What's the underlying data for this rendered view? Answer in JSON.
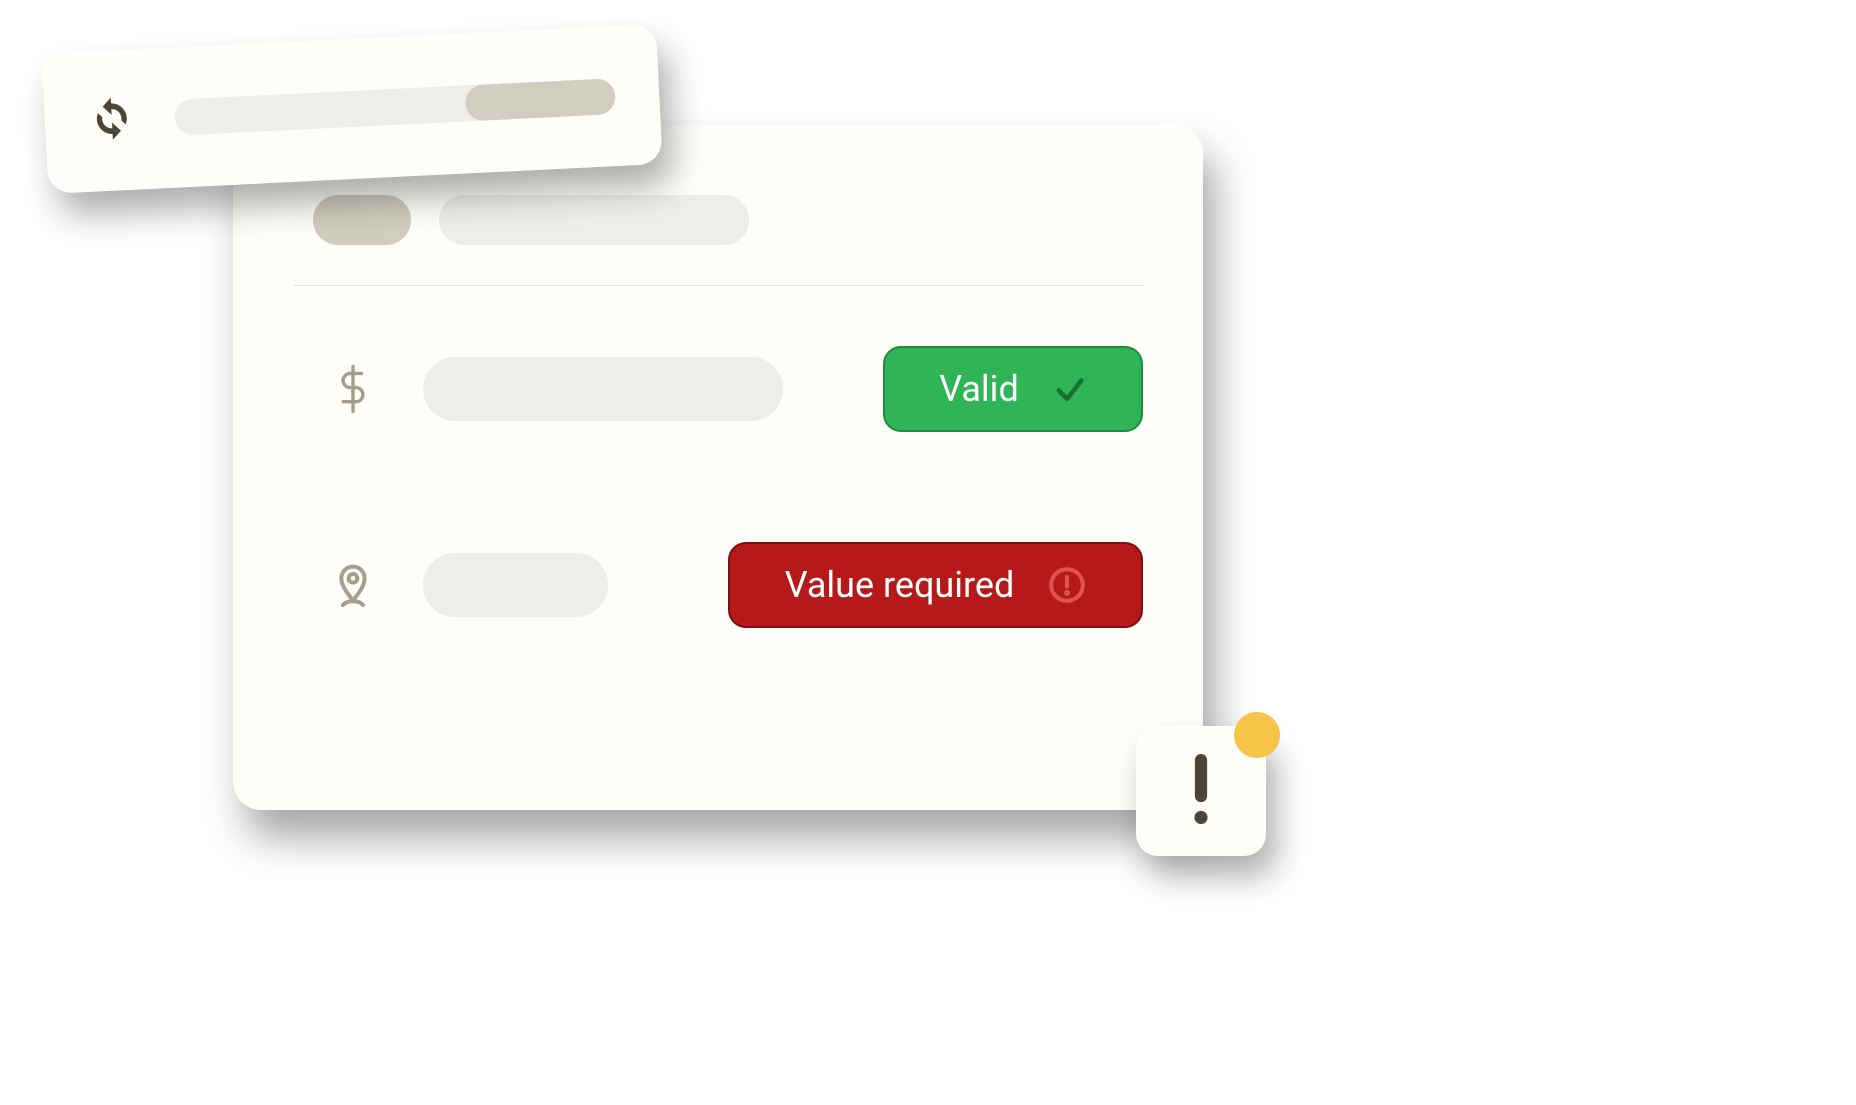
{
  "card": {
    "rows": [
      {
        "status": "valid",
        "status_label": "Valid",
        "icon": "dollar"
      },
      {
        "status": "error",
        "status_label": "Value required",
        "icon": "location"
      }
    ]
  },
  "colors": {
    "valid_bg": "#2fb457",
    "error_bg": "#b51919",
    "neutral_pill": "#efede8"
  }
}
